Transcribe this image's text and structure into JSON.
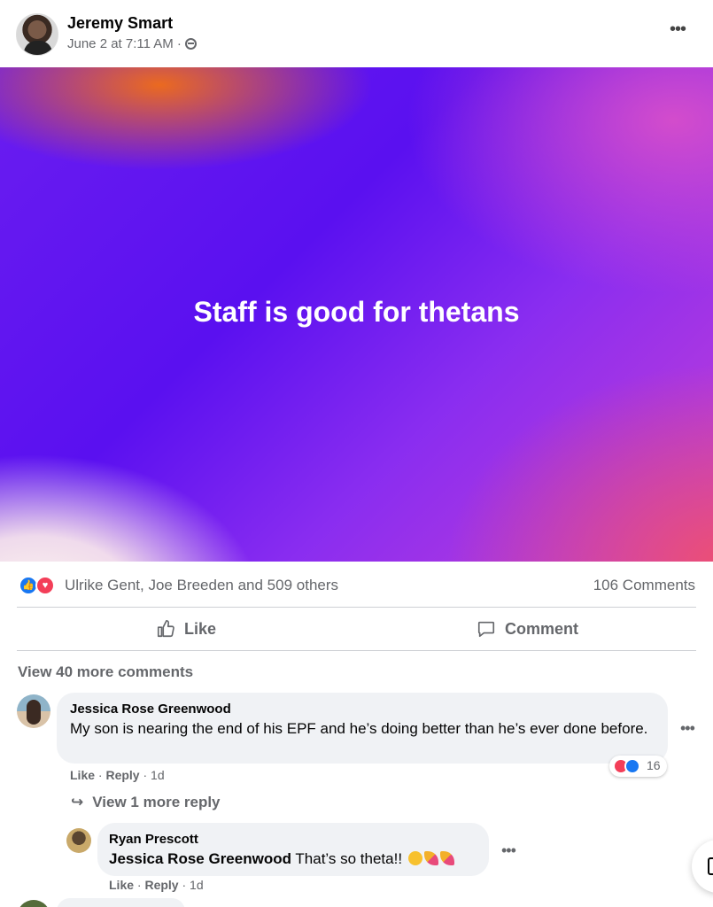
{
  "post": {
    "author": "Jeremy Smart",
    "timestamp": "June 2 at 7:11 AM",
    "audience_icon": "globe-icon",
    "more_label": "•••",
    "text": "Staff is good for thetans",
    "colors": {
      "banner_primary": "#5a10f0",
      "banner_accent_orange": "#f26e14",
      "banner_accent_pink": "#ee506e"
    }
  },
  "reactions": {
    "icons": [
      "like-reaction-icon",
      "love-reaction-icon"
    ],
    "like_glyph": "👍",
    "love_glyph": "♥",
    "summary": "Ulrike Gent, Joe Breeden and 509 others",
    "comments_count": "106 Comments"
  },
  "actions": {
    "like_label": "Like",
    "comment_label": "Comment"
  },
  "comments": {
    "view_more": "View 40 more comments",
    "items": [
      {
        "author": "Jessica Rose Greenwood",
        "text": "My son is nearing the end of his EPF and he’s doing better than he’s ever done before.",
        "reaction_count": "16",
        "like_label": "Like",
        "reply_label": "Reply",
        "age": "1d",
        "more_label": "•••",
        "view_replies": "View 1 more reply",
        "reply_arrow": "↪",
        "replies": [
          {
            "author": "Ryan Prescott",
            "mention": "Jessica Rose Greenwood",
            "text": " That’s so theta!!",
            "like_label": "Like",
            "reply_label": "Reply",
            "age": "1d",
            "more_label": "•••"
          }
        ]
      }
    ]
  },
  "sep": " · "
}
